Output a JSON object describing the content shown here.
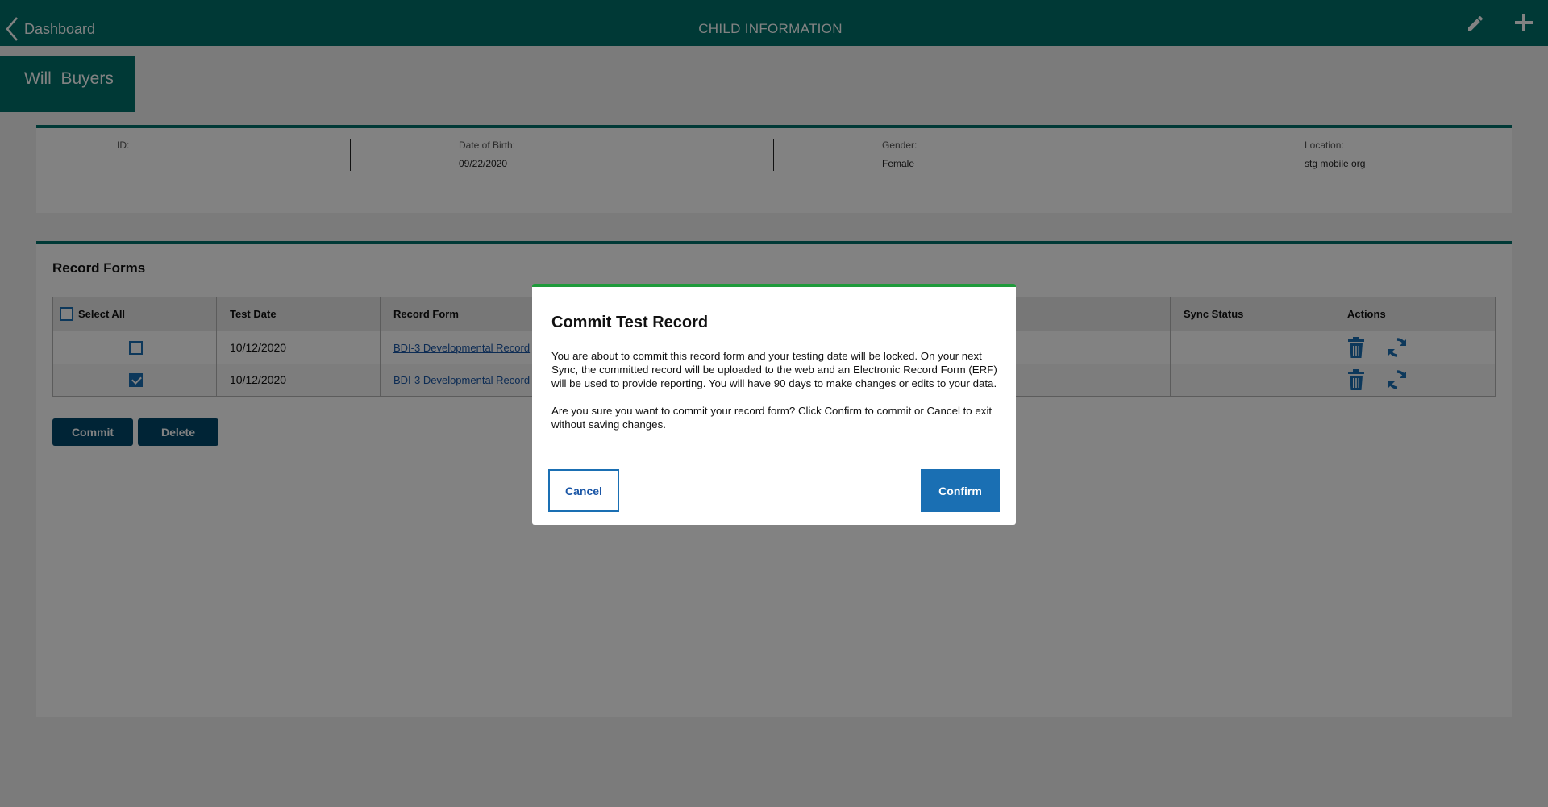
{
  "header": {
    "back_label": "Dashboard",
    "title": "CHILD INFORMATION",
    "accent_color": "#00706a"
  },
  "child": {
    "name": "Will  Buyers",
    "fields": [
      {
        "label": "ID:",
        "value": ""
      },
      {
        "label": "Date of Birth:",
        "value": "09/22/2020"
      },
      {
        "label": "Gender:",
        "value": "Female"
      },
      {
        "label": "Location:",
        "value": "stg mobile org"
      }
    ]
  },
  "record_forms": {
    "title": "Record Forms",
    "columns": [
      "Select All",
      "Test Date",
      "Record Form",
      "Sync Status",
      "Actions"
    ],
    "rows": [
      {
        "checked": false,
        "test_date": "10/12/2020",
        "record_form": "BDI-3 Developmental Record",
        "sync_status": ""
      },
      {
        "checked": true,
        "test_date": "10/12/2020",
        "record_form": "BDI-3 Developmental Record",
        "sync_status": ""
      }
    ],
    "commit_label": "Commit",
    "delete_label": "Delete"
  },
  "modal": {
    "title": "Commit Test Record",
    "paragraph1": "You are about to commit this record form and your testing date will be locked. On your next Sync, the committed record will be uploaded to the web and an Electronic Record Form (ERF) will be used to provide reporting. You will have 90 days to make changes or edits to your data.",
    "paragraph2": "Are you sure you want to commit your record form? Click Confirm to commit or Cancel to exit without saving changes.",
    "cancel_label": "Cancel",
    "confirm_label": "Confirm",
    "accent_color": "#1f9a3b"
  }
}
